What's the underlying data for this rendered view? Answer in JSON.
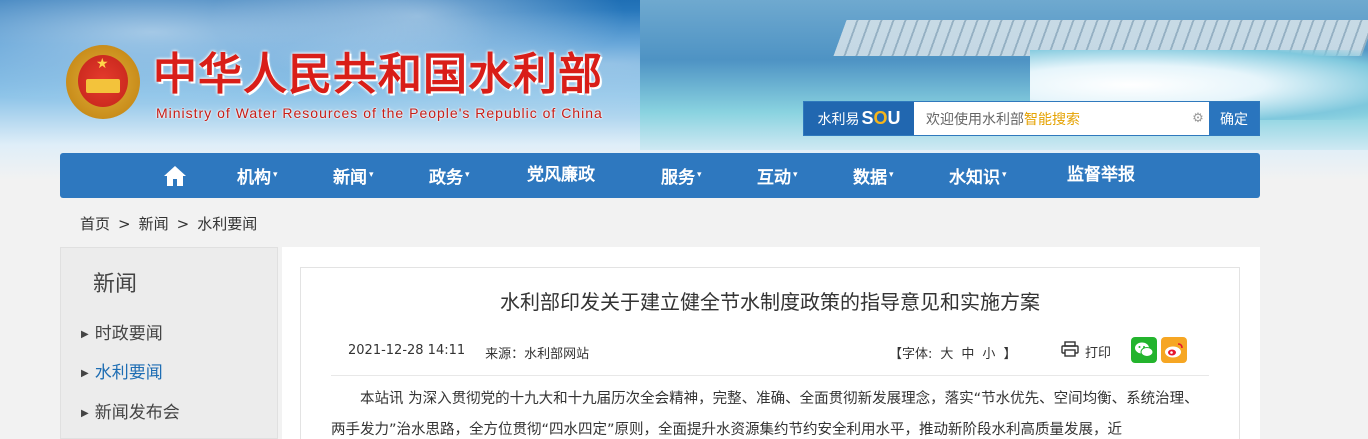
{
  "header": {
    "title_cn": "中华人民共和国水利部",
    "title_en": "Ministry of Water Resources of the People's Republic of China"
  },
  "search": {
    "brand_label": "水利易",
    "brand_sou": "SOU",
    "placeholder_prefix": "欢迎使用水利部",
    "placeholder_highlight": "智能搜索",
    "submit_label": "确定"
  },
  "nav": {
    "items": [
      {
        "label": "机构",
        "has_dropdown": true
      },
      {
        "label": "新闻",
        "has_dropdown": true
      },
      {
        "label": "政务",
        "has_dropdown": true
      },
      {
        "label": "党风廉政",
        "has_dropdown": false
      },
      {
        "label": "服务",
        "has_dropdown": true
      },
      {
        "label": "互动",
        "has_dropdown": true
      },
      {
        "label": "数据",
        "has_dropdown": true
      },
      {
        "label": "水知识",
        "has_dropdown": true
      },
      {
        "label": "监督举报",
        "has_dropdown": false
      }
    ]
  },
  "breadcrumb": {
    "items": [
      "首页",
      "新闻",
      "水利要闻"
    ],
    "separator": ">"
  },
  "sidebar": {
    "heading": "新闻",
    "items": [
      {
        "label": "时政要闻",
        "active": false
      },
      {
        "label": "水利要闻",
        "active": true
      },
      {
        "label": "新闻发布会",
        "active": false
      }
    ]
  },
  "article": {
    "title": "水利部印发关于建立健全节水制度政策的指导意见和实施方案",
    "date": "2021-12-28 14:11",
    "source_label": "来源：水利部网站",
    "font_label_open": "【字体:",
    "font_large": "大",
    "font_medium": "中",
    "font_small": "小",
    "font_label_close": "】",
    "print_label": "打印",
    "body": "本站讯 为深入贯彻党的十九大和十九届历次全会精神，完整、准确、全面贯彻新发展理念，落实“节水优先、空间均衡、系统治理、两手发力”治水思路，全方位贯彻“四水四定”原则，全面提升水资源集约节约安全利用水平，推动新阶段水利高质量发展，近"
  },
  "colors": {
    "nav_bg": "#2e78bf",
    "title_red": "#d91e18",
    "active_link": "#1e6db3",
    "wechat": "#23b42d",
    "weibo": "#f6a623"
  }
}
